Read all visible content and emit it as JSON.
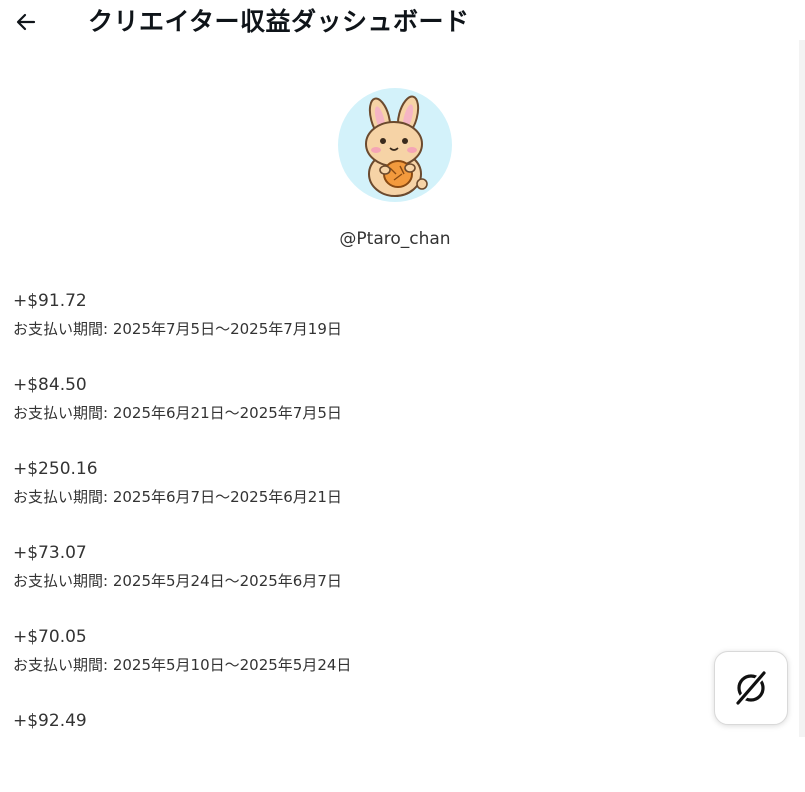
{
  "header": {
    "back_icon": "arrow-left-icon",
    "title": "クリエイター収益ダッシュボード"
  },
  "profile": {
    "avatar_icon": "bunny-avatar",
    "handle": "@Ptaro_chan"
  },
  "payouts": [
    {
      "amount": "+$91.72",
      "period": "お支払い期間: 2025年7月5日〜2025年7月19日"
    },
    {
      "amount": "+$84.50",
      "period": "お支払い期間: 2025年6月21日〜2025年7月5日"
    },
    {
      "amount": "+$250.16",
      "period": "お支払い期間: 2025年6月7日〜2025年6月21日"
    },
    {
      "amount": "+$73.07",
      "period": "お支払い期間: 2025年5月24日〜2025年6月7日"
    },
    {
      "amount": "+$70.05",
      "period": "お支払い期間: 2025年5月10日〜2025年5月24日"
    },
    {
      "amount": "+$92.49",
      "period": ""
    }
  ],
  "fab": {
    "icon": "grok-slash-icon"
  }
}
